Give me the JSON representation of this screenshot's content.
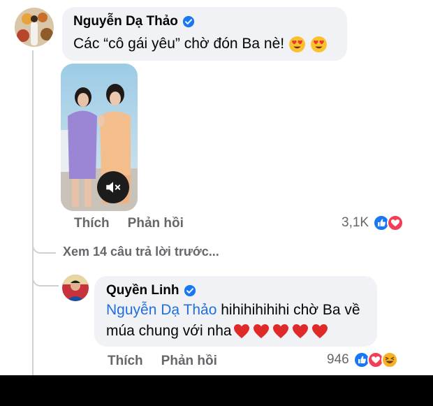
{
  "comment1": {
    "author": "Nguyễn Dạ Thảo",
    "text": "Các “cô gái yêu” chờ đón Ba nè!",
    "emojis": "heart-eyes-emoji x2",
    "actions": {
      "like": "Thích",
      "reply": "Phản hồi"
    },
    "reaction_count": "3,1K",
    "reaction_icons": [
      "like-icon",
      "love-icon"
    ]
  },
  "view_more_replies": "Xem 14 câu trả lời trước...",
  "reply1": {
    "author": "Quyền Linh",
    "mention": "Nguyễn Dạ Thảo",
    "text_line1": " hihihihihihi chờ Ba về",
    "text_line2": "múa chung với nha",
    "hearts": 5,
    "actions": {
      "like": "Thích",
      "reply": "Phản hồi"
    },
    "reaction_count": "946",
    "reaction_icons": [
      "like-icon",
      "love-icon",
      "haha-icon"
    ]
  },
  "colors": {
    "accent": "#216fdb",
    "like_blue": "#1877f2",
    "love_red": "#f33e58",
    "haha_yellow": "#f7b125",
    "bubble_bg": "#f0f2f5",
    "muted_text": "#65676b"
  }
}
